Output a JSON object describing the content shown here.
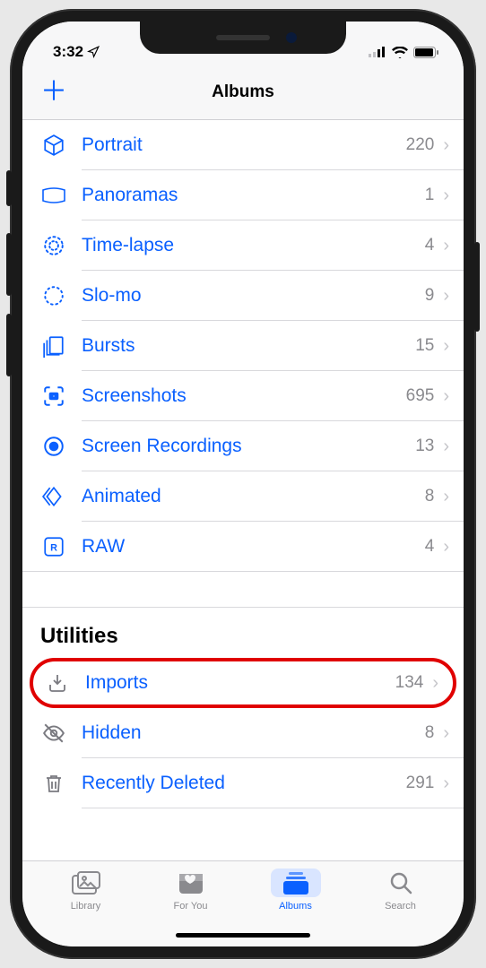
{
  "statusbar": {
    "time": "3:32"
  },
  "navbar": {
    "title": "Albums"
  },
  "mediaTypes": [
    {
      "key": "portrait",
      "label": "Portrait",
      "count": "220"
    },
    {
      "key": "panoramas",
      "label": "Panoramas",
      "count": "1"
    },
    {
      "key": "timelapse",
      "label": "Time-lapse",
      "count": "4"
    },
    {
      "key": "slomo",
      "label": "Slo-mo",
      "count": "9"
    },
    {
      "key": "bursts",
      "label": "Bursts",
      "count": "15"
    },
    {
      "key": "screenshots",
      "label": "Screenshots",
      "count": "695"
    },
    {
      "key": "screenrec",
      "label": "Screen Recordings",
      "count": "13"
    },
    {
      "key": "animated",
      "label": "Animated",
      "count": "8"
    },
    {
      "key": "raw",
      "label": "RAW",
      "count": "4"
    }
  ],
  "utilitiesHeader": "Utilities",
  "utilities": [
    {
      "key": "imports",
      "label": "Imports",
      "count": "134",
      "highlight": true
    },
    {
      "key": "hidden",
      "label": "Hidden",
      "count": "8"
    },
    {
      "key": "deleted",
      "label": "Recently Deleted",
      "count": "291"
    }
  ],
  "tabs": [
    {
      "key": "library",
      "label": "Library"
    },
    {
      "key": "foryou",
      "label": "For You"
    },
    {
      "key": "albums",
      "label": "Albums",
      "active": true
    },
    {
      "key": "search",
      "label": "Search"
    }
  ]
}
